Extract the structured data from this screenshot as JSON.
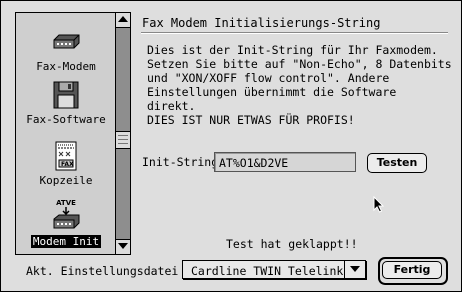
{
  "sidebar": {
    "items": [
      {
        "label": "Fax-Modem",
        "icon": "modem-icon",
        "selected": false
      },
      {
        "label": "Fax-Software",
        "icon": "floppy-disk-icon",
        "selected": false
      },
      {
        "label": "Kopzeile",
        "icon": "fax-header-icon",
        "selected": false
      },
      {
        "label": "Modem Init",
        "icon": "modem-init-icon",
        "selected": true,
        "icon_caption": "ATVE"
      }
    ]
  },
  "panel": {
    "title": "Fax Modem Initialisierungs-String",
    "description_lines": [
      "Dies ist der Init-String für Ihr Faxmodem.",
      "Setzen Sie bitte auf \"Non-Echo\", 8 Datenbits",
      "und \"XON/XOFF flow control\".  Andere",
      "Einstellungen übernimmt die Software",
      "direkt.",
      "DIES IST NUR ETWAS FÜR PROFIS!"
    ],
    "init_label": "Init-String",
    "init_value": "AT%O1&D2VE",
    "test_button": "Testen",
    "status": "Test hat geklappt!!"
  },
  "footer": {
    "settings_label": "Akt. Einstellungsdatei :",
    "settings_value": "Cardline TWIN Telelink",
    "done_button": "Fertig"
  }
}
